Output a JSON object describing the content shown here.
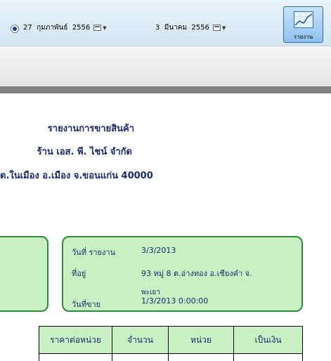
{
  "toolbar": {
    "start_date": "27  กุมภาพันธ์  2556",
    "end_date": "3  มีนาคม  2556",
    "report_button_label": "รายงาน"
  },
  "report": {
    "title": "รายงานการขายสินค้า",
    "shop_name": "ร้าน เอส. พี. ไชน์ จำกัด",
    "shop_address": "ต.ในเมือง อ.เมือง จ.ขอนแก่น 40000"
  },
  "info": {
    "report_date_label": "วันที่ รายงาน",
    "report_date": "3/3/2013",
    "address_label": "ที่อยู่",
    "address_line1": "93 หมู่ 8 ต.อ่างทอง อ.เชียงคำ จ.",
    "address_line2": "พะเยา",
    "sale_date_label": "วันที่ขาย",
    "sale_date": "1/3/2013   0:00:00"
  },
  "table": {
    "headers": [
      "ราคาต่อหน่วย",
      "จำนวน",
      "หน่วย",
      "เป็นเงิน"
    ]
  }
}
